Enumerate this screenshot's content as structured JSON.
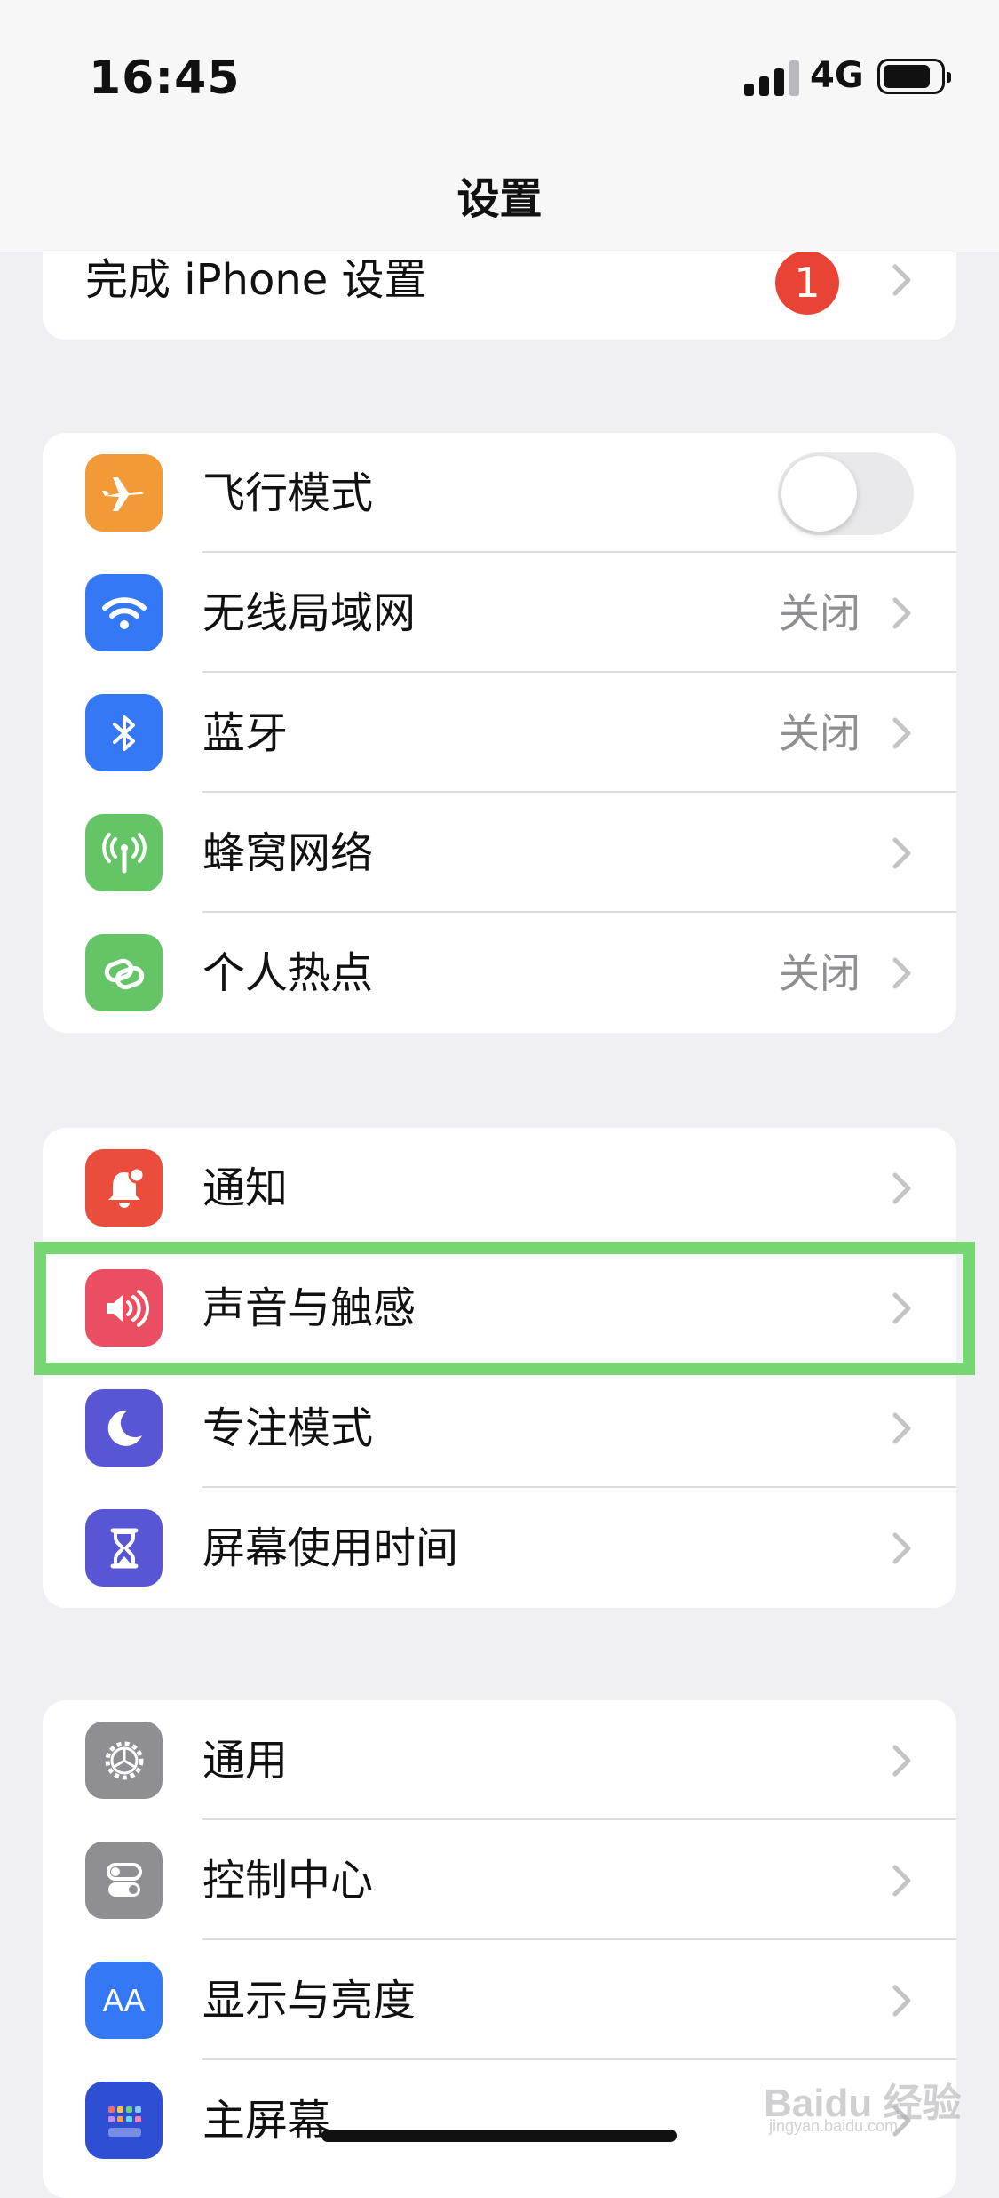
{
  "status_bar": {
    "time": "16:45",
    "network": "4G"
  },
  "nav": {
    "title": "设置"
  },
  "setup_row": {
    "label": "完成 iPhone 设置",
    "badge": "1"
  },
  "group_connectivity": [
    {
      "label": "飞行模式",
      "value": "",
      "icon": "airplane-icon",
      "color": "#f19a37",
      "toggle_on": false
    },
    {
      "label": "无线局域网",
      "value": "关闭",
      "icon": "wifi-icon",
      "color": "#3478f6"
    },
    {
      "label": "蓝牙",
      "value": "关闭",
      "icon": "bluetooth-icon",
      "color": "#3478f6"
    },
    {
      "label": "蜂窝网络",
      "value": "",
      "icon": "antenna-icon",
      "color": "#65c466"
    },
    {
      "label": "个人热点",
      "value": "关闭",
      "icon": "hotspot-link-icon",
      "color": "#65c466"
    }
  ],
  "group_notifications": [
    {
      "label": "通知",
      "icon": "bell-icon",
      "color": "#eb4d3d"
    },
    {
      "label": "声音与触感",
      "icon": "speaker-icon",
      "color": "#eb4e63"
    },
    {
      "label": "专注模式",
      "icon": "moon-icon",
      "color": "#5956d6"
    },
    {
      "label": "屏幕使用时间",
      "icon": "hourglass-icon",
      "color": "#5956d6"
    }
  ],
  "group_general": [
    {
      "label": "通用",
      "icon": "gear-icon",
      "color": "#8e8e93"
    },
    {
      "label": "控制中心",
      "icon": "toggles-icon",
      "color": "#8e8e93"
    },
    {
      "label": "显示与亮度",
      "icon": "text-size-icon",
      "color": "#3478f6",
      "glyph": "AA"
    },
    {
      "label": "主屏幕",
      "icon": "home-grid-icon",
      "color": "#2e4fd3"
    }
  ],
  "watermark": {
    "text": "Baidu 经验",
    "sub": "jingyan.baidu.com"
  }
}
